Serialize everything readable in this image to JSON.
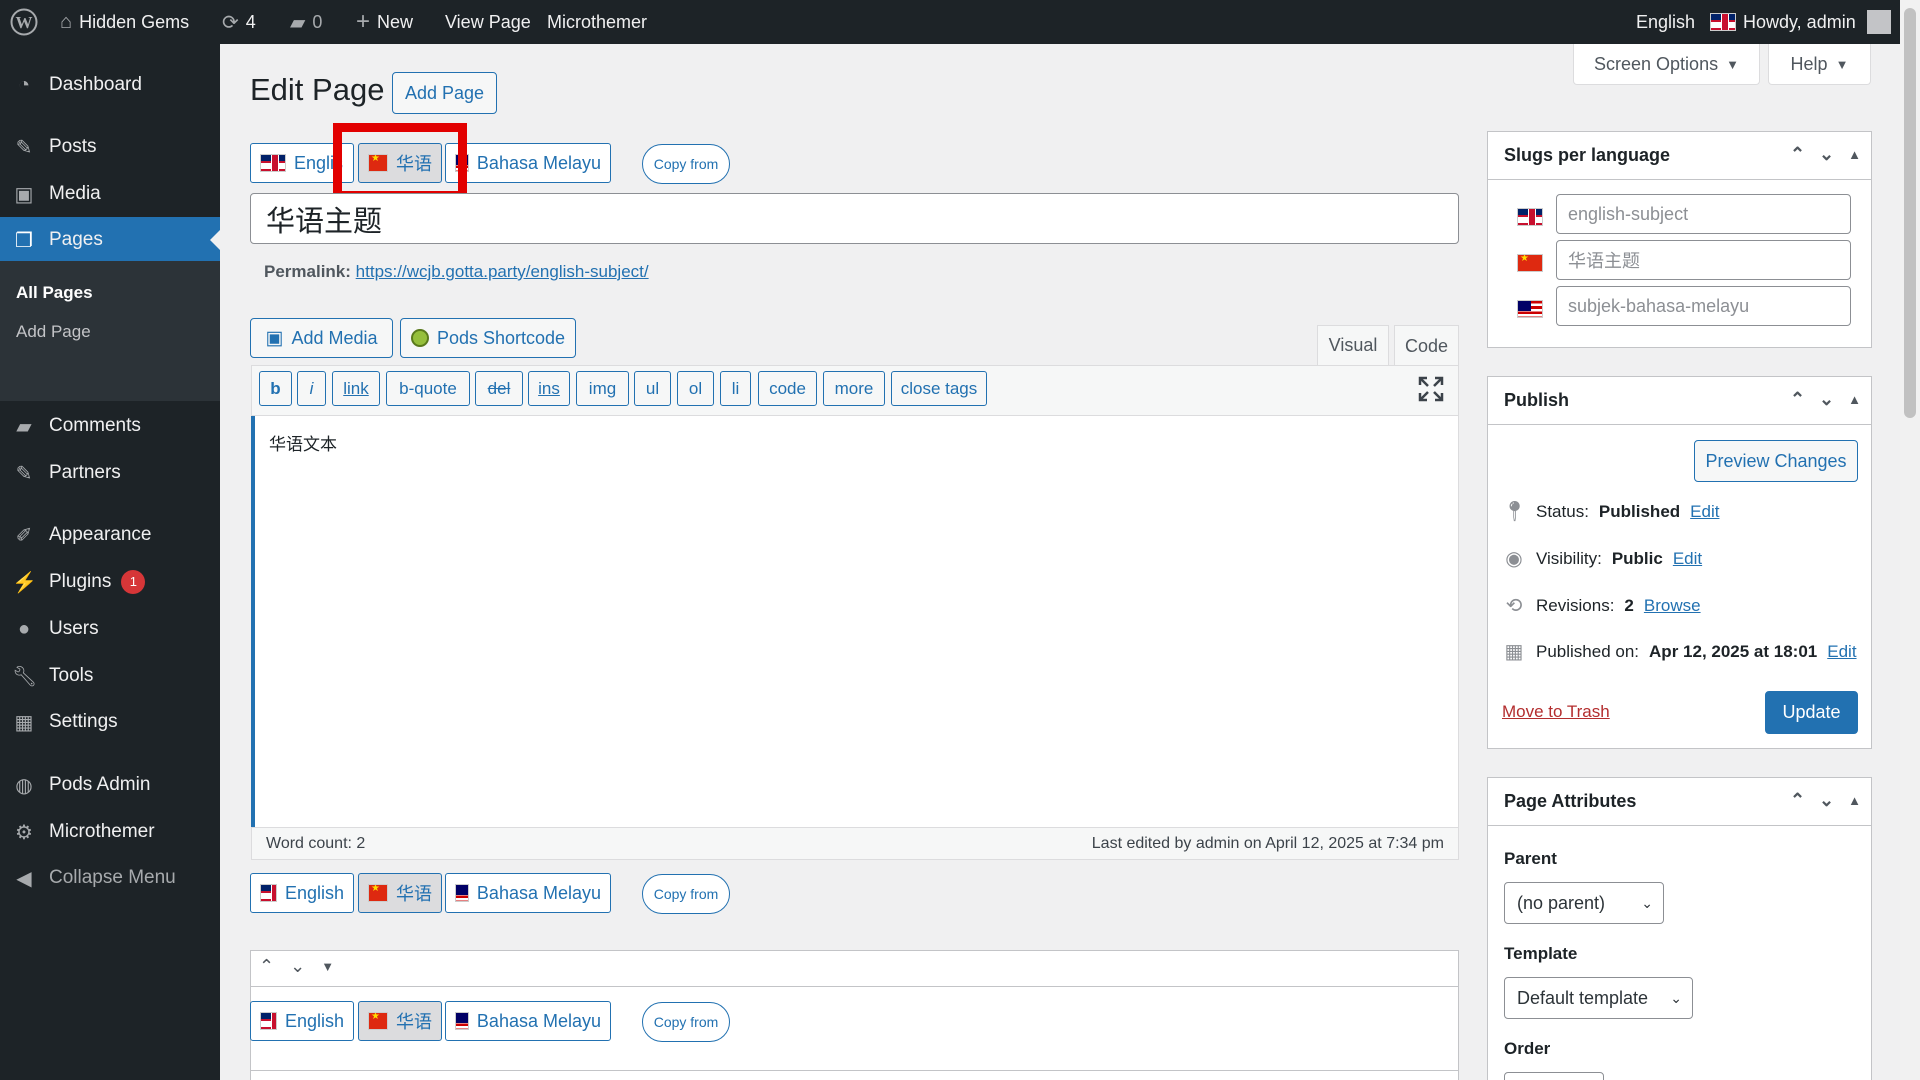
{
  "adminbar": {
    "site_name": "Hidden Gems",
    "updates": "4",
    "comments": "0",
    "new_label": "New",
    "view_page": "View Page",
    "microthemer": "Microthemer",
    "language": "English",
    "howdy": "Howdy, admin"
  },
  "sidebar": {
    "items": [
      {
        "label": "Dashboard",
        "icon": "dashboard-icon"
      },
      {
        "label": "Posts",
        "icon": "pin-icon"
      },
      {
        "label": "Media",
        "icon": "media-icon"
      },
      {
        "label": "Pages",
        "icon": "pages-icon"
      },
      {
        "label": "Comments",
        "icon": "comment-icon"
      },
      {
        "label": "Partners",
        "icon": "pin-icon"
      },
      {
        "label": "Appearance",
        "icon": "brush-icon"
      },
      {
        "label": "Plugins",
        "icon": "plugin-icon",
        "badge": "1"
      },
      {
        "label": "Users",
        "icon": "user-icon"
      },
      {
        "label": "Tools",
        "icon": "wrench-icon"
      },
      {
        "label": "Settings",
        "icon": "settings-icon"
      },
      {
        "label": "Pods Admin",
        "icon": "pods-icon"
      },
      {
        "label": "Microthemer",
        "icon": "gear-icon"
      },
      {
        "label": "Collapse Menu",
        "icon": "collapse-icon"
      }
    ],
    "submenu": [
      "All Pages",
      "Add Page"
    ]
  },
  "header": {
    "title": "Edit Page",
    "add_page": "Add Page",
    "screen_options": "Screen Options",
    "help": "Help"
  },
  "languages": [
    {
      "label": "English",
      "flag": "uk"
    },
    {
      "label": "华语",
      "flag": "cn"
    },
    {
      "label": "Bahasa Melayu",
      "flag": "my"
    }
  ],
  "lang_tabs_top": {
    "english": "Englis",
    "copy_from": "Copy from"
  },
  "copy_from": "Copy from",
  "post": {
    "title": "华语主题",
    "permalink_label": "Permalink:",
    "permalink_url": "https://wcjb.gotta.party/english-subject/",
    "content": "华语文本"
  },
  "editor": {
    "add_media": "Add Media",
    "pods_shortcode": "Pods Shortcode",
    "tab_visual": "Visual",
    "tab_code": "Code",
    "quicktags": [
      "b",
      "i",
      "link",
      "b-quote",
      "del",
      "ins",
      "img",
      "ul",
      "ol",
      "li",
      "code",
      "more",
      "close tags"
    ],
    "word_count": "Word count: 2",
    "last_edited": "Last edited by admin on April 12, 2025 at 7:34 pm"
  },
  "slugs": {
    "title": "Slugs per language",
    "values": [
      "english-subject",
      "华语主题",
      "subjek-bahasa-melayu"
    ]
  },
  "publish": {
    "title": "Publish",
    "preview": "Preview Changes",
    "status_label": "Status:",
    "status_value": "Published",
    "visibility_label": "Visibility:",
    "visibility_value": "Public",
    "revisions_label": "Revisions:",
    "revisions_value": "2",
    "browse": "Browse",
    "published_label": "Published on:",
    "published_value": "Apr 12, 2025 at 18:01",
    "edit": "Edit",
    "trash": "Move to Trash",
    "update": "Update"
  },
  "attributes": {
    "title": "Page Attributes",
    "parent_label": "Parent",
    "parent_value": "(no parent)",
    "template_label": "Template",
    "template_value": "Default template",
    "order_label": "Order"
  },
  "colors": {
    "accent": "#2271b1",
    "sidebar": "#1d2327",
    "highlight": "#e20000"
  }
}
